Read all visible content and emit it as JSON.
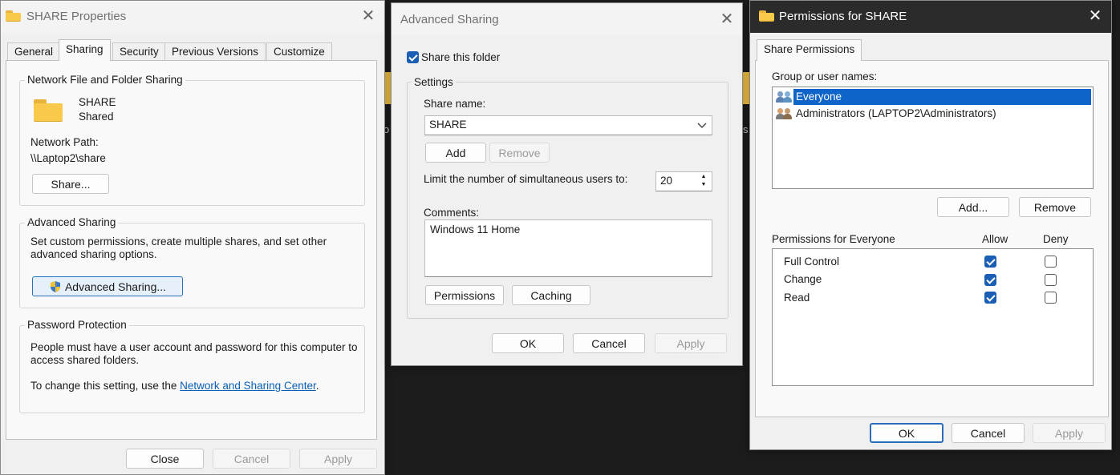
{
  "share_properties": {
    "title": "SHARE Properties",
    "tabs": [
      "General",
      "Sharing",
      "Security",
      "Previous Versions",
      "Customize"
    ],
    "network_group": {
      "label": "Network File and Folder Sharing",
      "folder_name": "SHARE",
      "folder_status": "Shared",
      "network_path_label": "Network Path:",
      "network_path": "\\\\Laptop2\\share",
      "share_button": "Share..."
    },
    "advanced_group": {
      "label": "Advanced Sharing",
      "description_line1": "Set custom permissions, create multiple shares, and set other",
      "description_line2": "advanced sharing options.",
      "button": "Advanced Sharing..."
    },
    "password_group": {
      "label": "Password Protection",
      "text_line1": "People must have a user account and password for this computer to",
      "text_line2": "access shared folders.",
      "change_prefix": "To change this setting, use the ",
      "link": "Network and Sharing Center",
      "change_suffix": "."
    },
    "buttons": {
      "close": "Close",
      "cancel": "Cancel",
      "apply": "Apply"
    }
  },
  "advanced_sharing": {
    "title": "Advanced Sharing",
    "share_checkbox_label": "Share this folder",
    "settings_label": "Settings",
    "share_name_label": "Share name:",
    "share_name_value": "SHARE",
    "add_button": "Add",
    "remove_button": "Remove",
    "limit_label": "Limit the number of simultaneous users to:",
    "limit_value": "20",
    "comments_label": "Comments:",
    "comments_value": "Windows 11 Home",
    "permissions_button": "Permissions",
    "caching_button": "Caching",
    "buttons": {
      "ok": "OK",
      "cancel": "Cancel",
      "apply": "Apply"
    }
  },
  "permissions": {
    "title": "Permissions for SHARE",
    "tab": "Share Permissions",
    "group_label": "Group or user names:",
    "users": [
      {
        "name": "Everyone",
        "selected": true
      },
      {
        "name": "Administrators (LAPTOP2\\Administrators)",
        "selected": false
      }
    ],
    "add_button": "Add...",
    "remove_button": "Remove",
    "perm_label": "Permissions for Everyone",
    "allow_label": "Allow",
    "deny_label": "Deny",
    "rows": [
      {
        "name": "Full Control",
        "allow": true,
        "deny": false
      },
      {
        "name": "Change",
        "allow": true,
        "deny": false
      },
      {
        "name": "Read",
        "allow": true,
        "deny": false
      }
    ],
    "buttons": {
      "ok": "OK",
      "cancel": "Cancel",
      "apply": "Apply"
    }
  }
}
